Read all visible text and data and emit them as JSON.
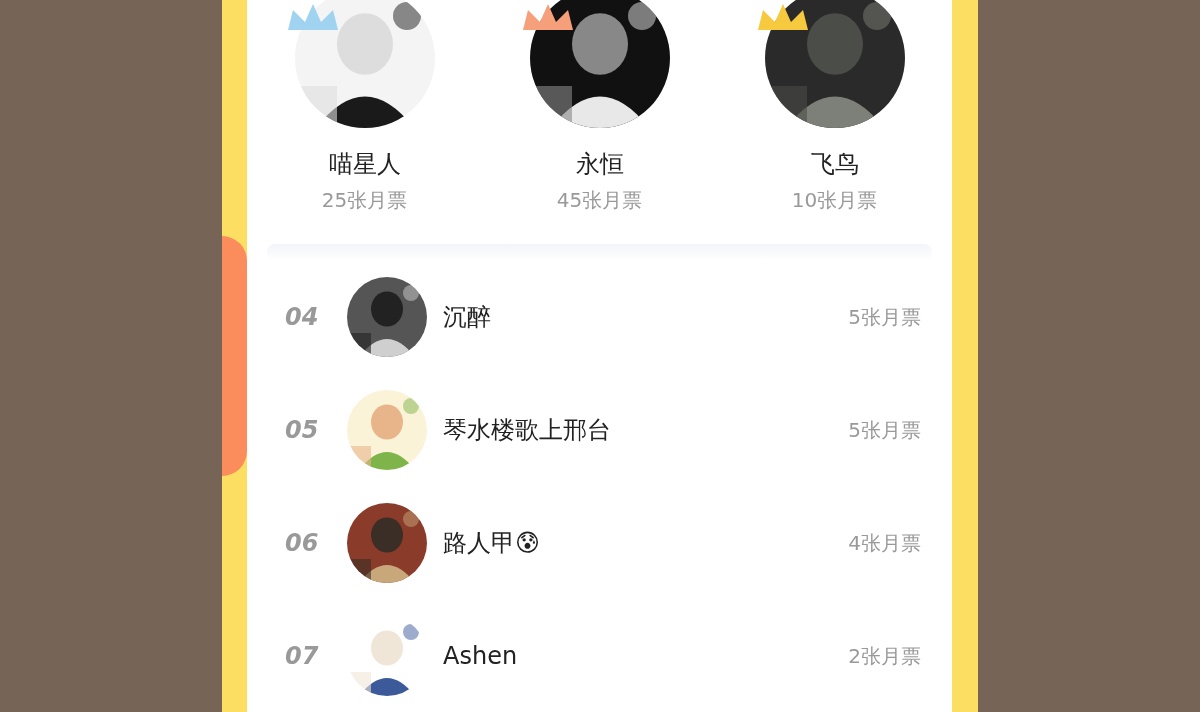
{
  "podium": [
    {
      "name": "喵星人",
      "votes": "25张月票",
      "color": "#9fd3f0"
    },
    {
      "name": "永恒",
      "votes": "45张月票",
      "color": "#f5a07a"
    },
    {
      "name": "飞鸟",
      "votes": "10张月票",
      "color": "#f7c93e"
    }
  ],
  "ranking": [
    {
      "rank": "04",
      "name": "沉醉",
      "votes": "5张月票"
    },
    {
      "rank": "05",
      "name": "琴水楼歌上邢台",
      "votes": "5张月票"
    },
    {
      "rank": "06",
      "name": "路人甲😰",
      "votes": "4张月票"
    },
    {
      "rank": "07",
      "name": "Ashen",
      "votes": "2张月票"
    }
  ]
}
